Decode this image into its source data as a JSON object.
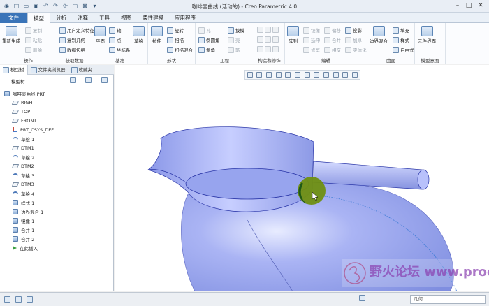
{
  "window": {
    "title": "咖啡壶曲线 (活动的) - Creo Parametric 4.0"
  },
  "tabs": [
    "文件",
    "模型",
    "分析",
    "注释",
    "工具",
    "视图",
    "柔性建模",
    "应用程序"
  ],
  "ribbon": {
    "groups": [
      {
        "label": "操作",
        "big": [
          "重新生成"
        ],
        "small": [
          "复制",
          "粘贴",
          "删除"
        ]
      },
      {
        "label": "获取数据",
        "small": [
          "用户定义特征",
          "复制几何",
          "收缩包络"
        ]
      },
      {
        "label": "基准",
        "big": [
          "平面",
          "草绘"
        ],
        "small": [
          "轴",
          "点",
          "坐标系"
        ]
      },
      {
        "label": "形状",
        "big": [
          "拉伸"
        ],
        "small": [
          "旋转",
          "扫描",
          "扫描混合"
        ]
      },
      {
        "label": "工程",
        "small": [
          "孔",
          "倒圆角",
          "倒角",
          "拔模",
          "壳",
          "筋"
        ]
      },
      {
        "label": "构造和修饰",
        "small": []
      },
      {
        "label": "编辑",
        "big": [
          "阵列"
        ],
        "small": [
          "镜像",
          "延伸",
          "修剪",
          "偏移",
          "合并",
          "相交",
          "投影",
          "加厚",
          "实体化"
        ]
      },
      {
        "label": "曲面",
        "big": [
          "边界混合"
        ],
        "small": [
          "填充",
          "样式",
          "自由式"
        ]
      },
      {
        "label": "模型意图",
        "big": [
          "元件界面"
        ]
      }
    ]
  },
  "leftpanel": {
    "tabs": [
      "模型树",
      "文件夹浏览器",
      "收藏夹"
    ],
    "tree_label": "模型树",
    "items": [
      {
        "label": "咖啡壶曲线.PRT",
        "icon": "part-icon"
      },
      {
        "label": "RIGHT",
        "icon": "plane-icon"
      },
      {
        "label": "TOP",
        "icon": "plane-icon"
      },
      {
        "label": "FRONT",
        "icon": "plane-icon"
      },
      {
        "label": "PRT_CSYS_DEF",
        "icon": "csys-icon"
      },
      {
        "label": "草绘 1",
        "icon": "sketch-icon"
      },
      {
        "label": "DTM1",
        "icon": "plane-icon"
      },
      {
        "label": "草绘 2",
        "icon": "sketch-icon"
      },
      {
        "label": "DTM2",
        "icon": "plane-icon"
      },
      {
        "label": "草绘 3",
        "icon": "sketch-icon"
      },
      {
        "label": "DTM3",
        "icon": "plane-icon"
      },
      {
        "label": "草绘 4",
        "icon": "sketch-icon"
      },
      {
        "label": "样式 1",
        "icon": "style-icon"
      },
      {
        "label": "边界混合 1",
        "icon": "boundary-icon"
      },
      {
        "label": "镜像 1",
        "icon": "mirror-icon"
      },
      {
        "label": "合并 1",
        "icon": "merge-icon"
      },
      {
        "label": "合并 2",
        "icon": "merge-icon"
      },
      {
        "label": "在此插入",
        "icon": "insert-arrow-icon"
      }
    ]
  },
  "status": {
    "filter_value": "几何"
  },
  "colors": {
    "file_tab": "#3a74b8",
    "model_surface": "#9aa8f0",
    "selection_highlight": "#5a8a10"
  },
  "watermark": "野火论坛 www.proewildfire.cn"
}
